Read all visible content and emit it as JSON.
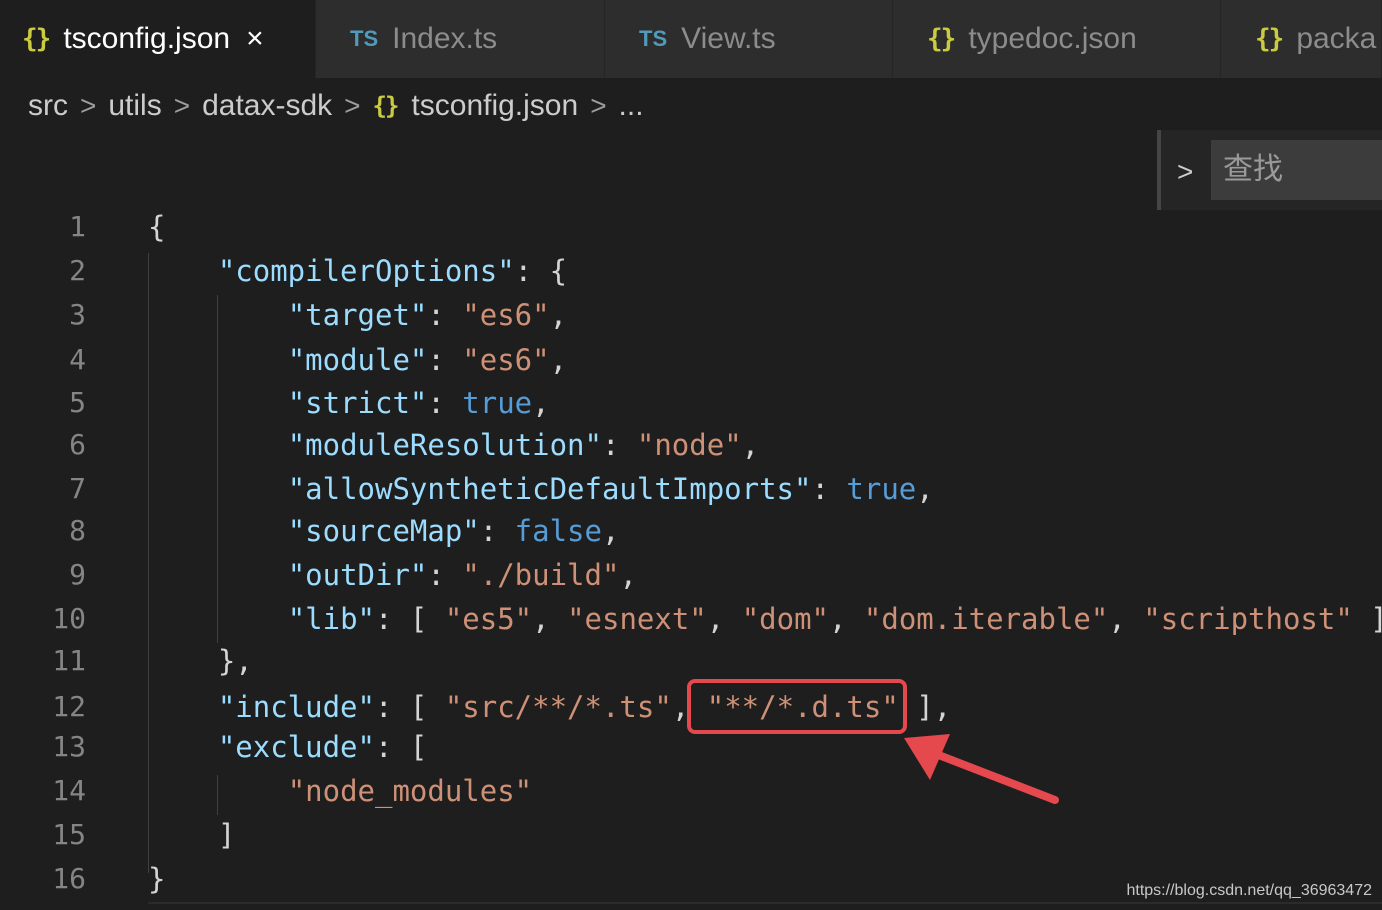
{
  "tabs": [
    {
      "icon": "{}",
      "icon_type": "json",
      "label": "tsconfig.json",
      "close": "×",
      "active": true
    },
    {
      "icon": "TS",
      "icon_type": "ts",
      "label": "Index.ts"
    },
    {
      "icon": "TS",
      "icon_type": "ts",
      "label": "View.ts"
    },
    {
      "icon": "{}",
      "icon_type": "json",
      "label": "typedoc.json"
    },
    {
      "icon": "{}",
      "icon_type": "json",
      "label": "packa"
    }
  ],
  "breadcrumb": {
    "items": [
      "src",
      "utils",
      "datax-sdk"
    ],
    "file_icon": "{}",
    "file": "tsconfig.json",
    "ellipsis": "...",
    "sep": ">"
  },
  "find": {
    "toggle": ">",
    "placeholder": "查找"
  },
  "lines": [
    {
      "n": "1",
      "tokens": [
        {
          "t": "{",
          "c": "p"
        }
      ]
    },
    {
      "n": "2",
      "tokens": [
        {
          "t": "    ",
          "c": "p"
        },
        {
          "t": "\"compilerOptions\"",
          "c": "k"
        },
        {
          "t": ": {",
          "c": "p"
        }
      ]
    },
    {
      "n": "3",
      "tokens": [
        {
          "t": "        ",
          "c": "p"
        },
        {
          "t": "\"target\"",
          "c": "k"
        },
        {
          "t": ": ",
          "c": "p"
        },
        {
          "t": "\"es6\"",
          "c": "s"
        },
        {
          "t": ",",
          "c": "p"
        }
      ]
    },
    {
      "n": "4",
      "tokens": [
        {
          "t": "        ",
          "c": "p"
        },
        {
          "t": "\"module\"",
          "c": "k"
        },
        {
          "t": ": ",
          "c": "p"
        },
        {
          "t": "\"es6\"",
          "c": "s"
        },
        {
          "t": ",",
          "c": "p"
        }
      ]
    },
    {
      "n": "5",
      "tokens": [
        {
          "t": "        ",
          "c": "p"
        },
        {
          "t": "\"strict\"",
          "c": "k"
        },
        {
          "t": ": ",
          "c": "p"
        },
        {
          "t": "true",
          "c": "b"
        },
        {
          "t": ",",
          "c": "p"
        }
      ]
    },
    {
      "n": "6",
      "tokens": [
        {
          "t": "        ",
          "c": "p"
        },
        {
          "t": "\"moduleResolution\"",
          "c": "k"
        },
        {
          "t": ": ",
          "c": "p"
        },
        {
          "t": "\"node\"",
          "c": "s"
        },
        {
          "t": ",",
          "c": "p"
        }
      ]
    },
    {
      "n": "7",
      "tokens": [
        {
          "t": "        ",
          "c": "p"
        },
        {
          "t": "\"allowSyntheticDefaultImports\"",
          "c": "k"
        },
        {
          "t": ": ",
          "c": "p"
        },
        {
          "t": "true",
          "c": "b"
        },
        {
          "t": ",",
          "c": "p"
        }
      ]
    },
    {
      "n": "8",
      "tokens": [
        {
          "t": "        ",
          "c": "p"
        },
        {
          "t": "\"sourceMap\"",
          "c": "k"
        },
        {
          "t": ": ",
          "c": "p"
        },
        {
          "t": "false",
          "c": "b"
        },
        {
          "t": ",",
          "c": "p"
        }
      ]
    },
    {
      "n": "9",
      "tokens": [
        {
          "t": "        ",
          "c": "p"
        },
        {
          "t": "\"outDir\"",
          "c": "k"
        },
        {
          "t": ": ",
          "c": "p"
        },
        {
          "t": "\"./build\"",
          "c": "s"
        },
        {
          "t": ",",
          "c": "p"
        }
      ]
    },
    {
      "n": "10",
      "tokens": [
        {
          "t": "        ",
          "c": "p"
        },
        {
          "t": "\"lib\"",
          "c": "k"
        },
        {
          "t": ": [ ",
          "c": "p"
        },
        {
          "t": "\"es5\"",
          "c": "s"
        },
        {
          "t": ", ",
          "c": "p"
        },
        {
          "t": "\"esnext\"",
          "c": "s"
        },
        {
          "t": ", ",
          "c": "p"
        },
        {
          "t": "\"dom\"",
          "c": "s"
        },
        {
          "t": ", ",
          "c": "p"
        },
        {
          "t": "\"dom.iterable\"",
          "c": "s"
        },
        {
          "t": ", ",
          "c": "p"
        },
        {
          "t": "\"scripthost\"",
          "c": "s"
        },
        {
          "t": " ]",
          "c": "p"
        }
      ]
    },
    {
      "n": "11",
      "tokens": [
        {
          "t": "    },",
          "c": "p"
        }
      ]
    },
    {
      "n": "12",
      "tokens": [
        {
          "t": "    ",
          "c": "p"
        },
        {
          "t": "\"include\"",
          "c": "k"
        },
        {
          "t": ": [ ",
          "c": "p"
        },
        {
          "t": "\"src/**/*.ts\"",
          "c": "s"
        },
        {
          "t": ", ",
          "c": "p"
        },
        {
          "t": "\"**/*.d.ts\"",
          "c": "s"
        },
        {
          "t": " ],",
          "c": "p"
        }
      ]
    },
    {
      "n": "13",
      "tokens": [
        {
          "t": "    ",
          "c": "p"
        },
        {
          "t": "\"exclude\"",
          "c": "k"
        },
        {
          "t": ": [",
          "c": "p"
        }
      ]
    },
    {
      "n": "14",
      "tokens": [
        {
          "t": "        ",
          "c": "p"
        },
        {
          "t": "\"node_modules\"",
          "c": "s"
        }
      ]
    },
    {
      "n": "15",
      "tokens": [
        {
          "t": "    ]",
          "c": "p"
        }
      ]
    },
    {
      "n": "16",
      "tokens": [
        {
          "t": "}",
          "c": "p"
        }
      ]
    }
  ],
  "annotation": {
    "color": "#e5484d"
  },
  "watermark": "https://blog.csdn.net/qq_36963472"
}
